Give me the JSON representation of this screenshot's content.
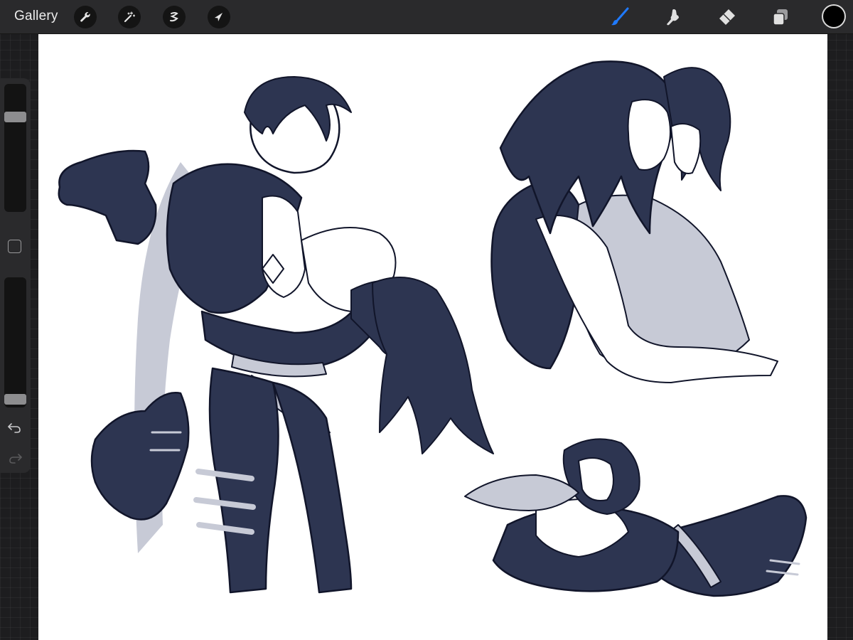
{
  "toolbar": {
    "gallery_label": "Gallery",
    "left_tools": [
      {
        "icon": "wrench-icon",
        "name": "actions"
      },
      {
        "icon": "magic-wand-icon",
        "name": "adjustments"
      },
      {
        "icon": "selection-icon",
        "name": "selection"
      },
      {
        "icon": "arrow-cursor-icon",
        "name": "transform"
      }
    ],
    "right_tools": [
      {
        "icon": "brush-icon",
        "name": "paint",
        "active": true
      },
      {
        "icon": "smudge-icon",
        "name": "smudge"
      },
      {
        "icon": "eraser-icon",
        "name": "eraser"
      },
      {
        "icon": "layers-icon",
        "name": "layers"
      }
    ],
    "current_color": "#000000",
    "active_tool_color": "#1f7aff"
  },
  "sidebar": {
    "brush_size_level": 0.78,
    "brush_opacity_level": 0.0,
    "icons": [
      "square-modifier-icon",
      "undo-icon",
      "redo-icon"
    ]
  },
  "canvas": {
    "ink_color": "#2d3551",
    "shade_color": "#c7cad6",
    "background": "#ffffff"
  }
}
